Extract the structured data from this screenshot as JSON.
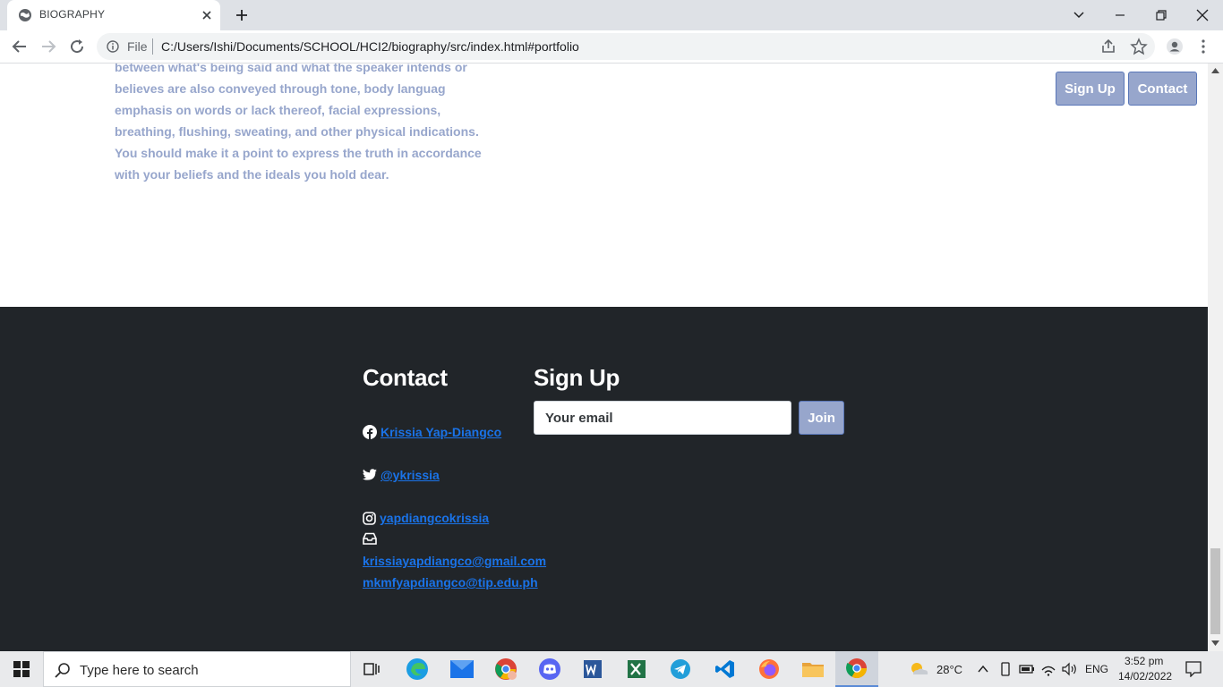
{
  "browser": {
    "tab_title": "BIOGRAPHY",
    "omnibox_scheme": "File",
    "url": "C:/Users/Ishi/Documents/SCHOOL/HCI2/biography/src/index.html#portfolio"
  },
  "page": {
    "bio_paragraph": "between what's being said and what the speaker intends or believes are also conveyed through tone, body languag emphasis on words or lack thereof, facial expressions, breathing, flushing, sweating, and other physical indications. You should make it a point to express the truth in accordance with your beliefs and the ideals you hold dear.",
    "nav": {
      "signup_label": "Sign Up",
      "contact_label": "Contact"
    },
    "footer": {
      "contact_heading": "Contact",
      "signup_heading": "Sign Up",
      "facebook": "Krissia Yap-Diangco",
      "twitter": "@ykrissia",
      "instagram": "yapdiangcokrissia",
      "email1": "krissiayapdiangco@gmail.com",
      "email2": "mkmfyapdiangco@tip.edu.ph",
      "email_placeholder": "Your email",
      "join_label": "Join"
    }
  },
  "taskbar": {
    "search_placeholder": "Type here to search",
    "weather_temp": "28°C",
    "language": "ENG",
    "time": "3:52 pm",
    "date": "14/02/2022"
  },
  "colors": {
    "accent": "#97a6cc",
    "footer_bg": "#212529",
    "link": "#1a73e8"
  }
}
